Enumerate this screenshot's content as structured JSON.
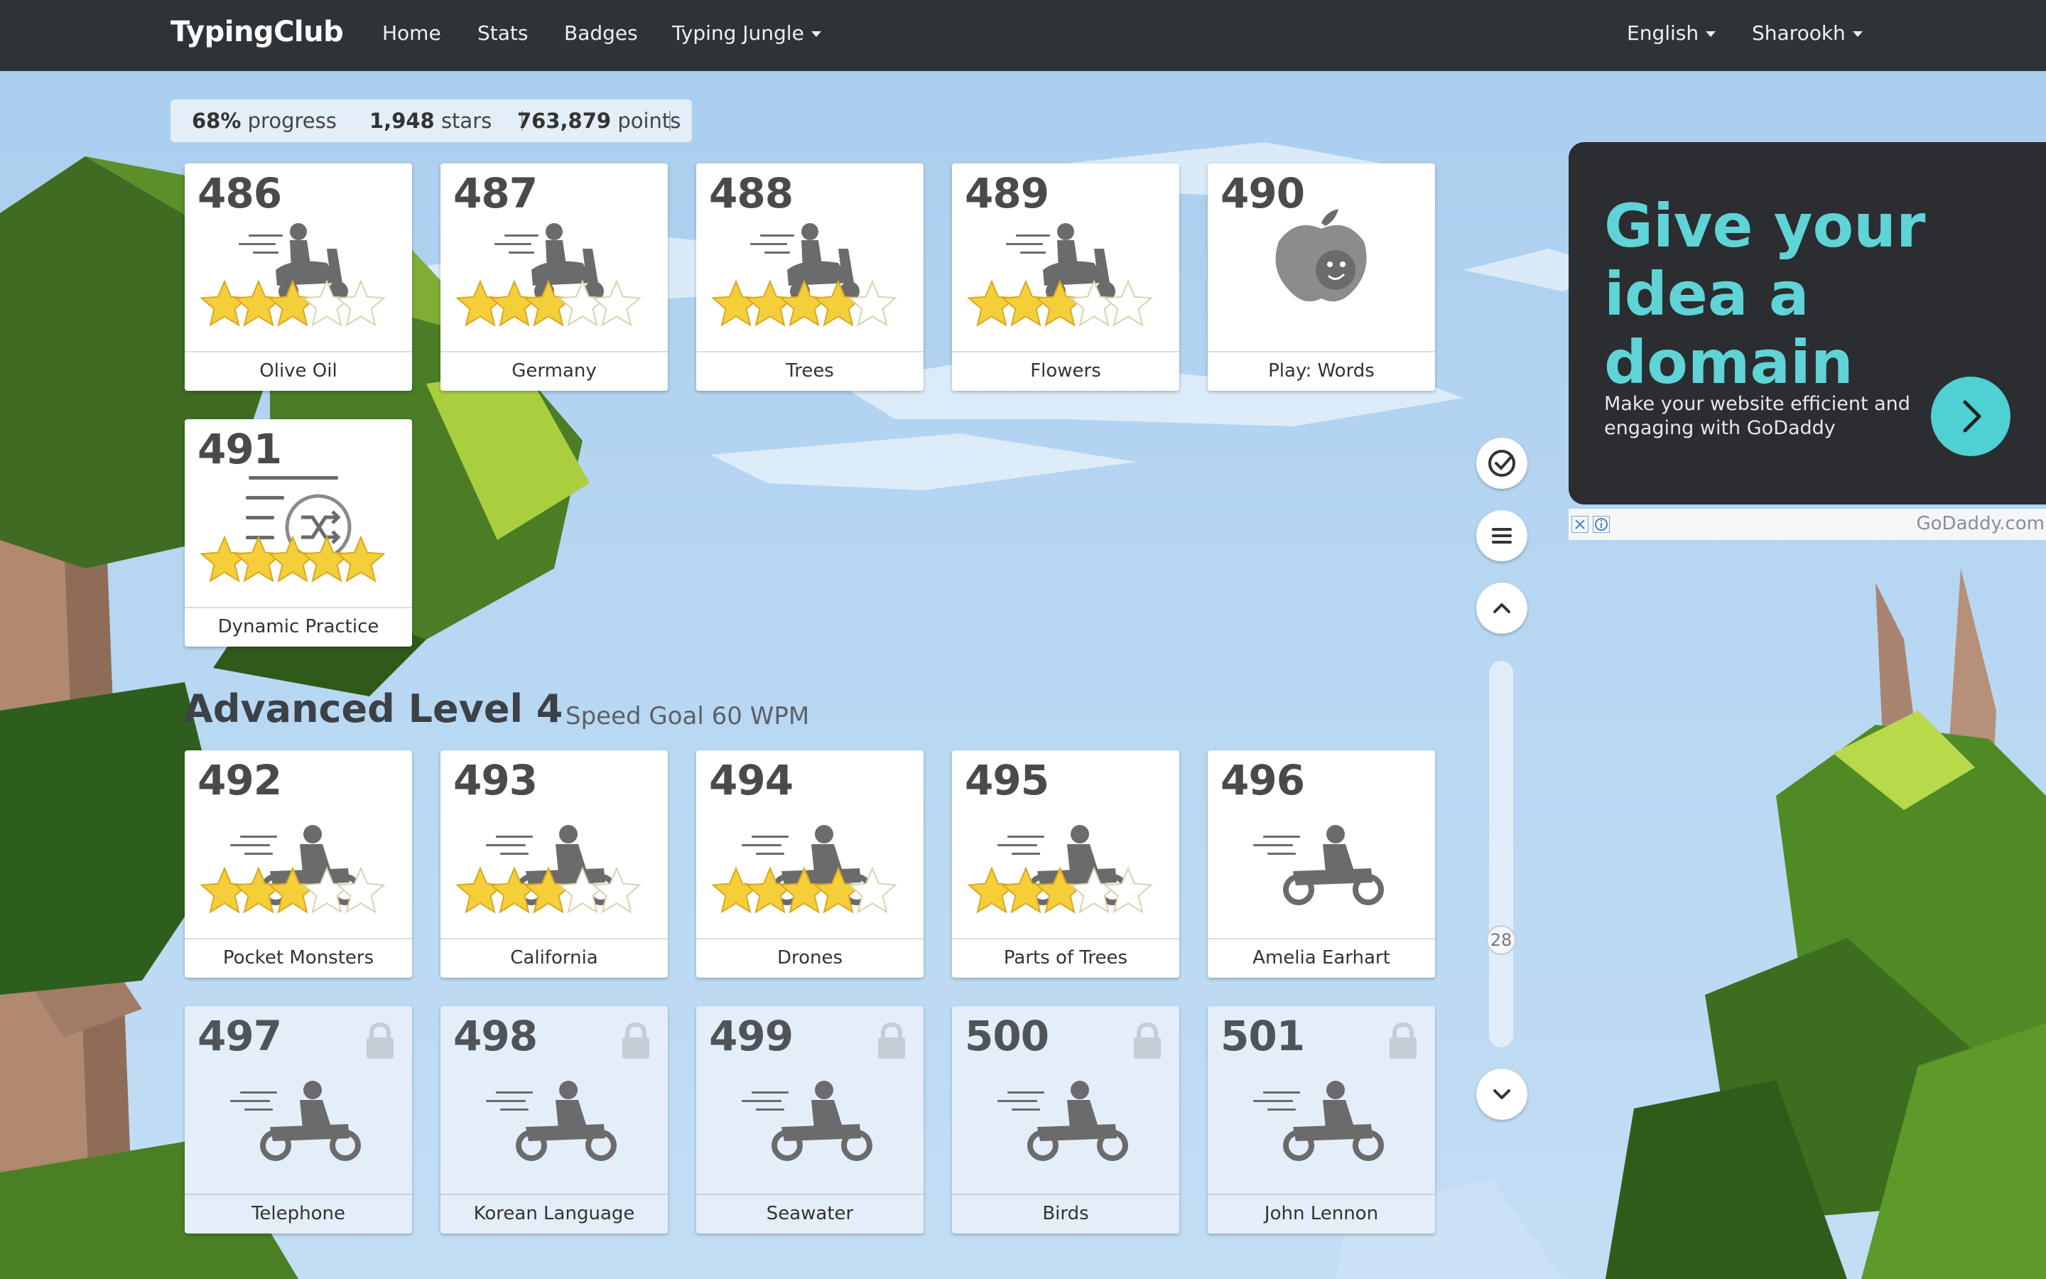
{
  "navbar": {
    "brand": "TypingClub",
    "links": [
      "Home",
      "Stats",
      "Badges",
      "Typing Jungle"
    ],
    "language": "English",
    "user": "Sharookh"
  },
  "stats": {
    "progress_value": "68%",
    "progress_label": "progress",
    "stars_value": "1,948",
    "stars_label": "stars",
    "points_value": "763,879",
    "points_label": "points"
  },
  "lessons_top": [
    {
      "num": "486",
      "label": "Olive Oil",
      "icon": "scooter-rider-icon",
      "stars": 3
    },
    {
      "num": "487",
      "label": "Germany",
      "icon": "scooter-rider-icon",
      "stars": 3
    },
    {
      "num": "488",
      "label": "Trees",
      "icon": "scooter-rider-icon",
      "stars": 4
    },
    {
      "num": "489",
      "label": "Flowers",
      "icon": "scooter-rider-icon",
      "stars": 3
    },
    {
      "num": "490",
      "label": "Play: Words",
      "icon": "apple-game-icon",
      "stars": 0
    },
    {
      "num": "491",
      "label": "Dynamic Practice",
      "icon": "shuffle-list-icon",
      "stars": 5
    }
  ],
  "section": {
    "title": "Advanced Level 4",
    "subtitle": "Speed Goal 60 WPM"
  },
  "lessons_advanced": [
    {
      "num": "492",
      "label": "Pocket Monsters",
      "icon": "motorcycle-rider-icon",
      "stars": 3,
      "locked": false
    },
    {
      "num": "493",
      "label": "California",
      "icon": "motorcycle-rider-icon",
      "stars": 3,
      "locked": false
    },
    {
      "num": "494",
      "label": "Drones",
      "icon": "motorcycle-rider-icon",
      "stars": 4,
      "locked": false
    },
    {
      "num": "495",
      "label": "Parts of Trees",
      "icon": "motorcycle-rider-icon",
      "stars": 3,
      "locked": false
    },
    {
      "num": "496",
      "label": "Amelia Earhart",
      "icon": "motorcycle-rider-icon",
      "stars": 0,
      "locked": false
    },
    {
      "num": "497",
      "label": "Telephone",
      "icon": "motorcycle-rider-icon",
      "stars": 0,
      "locked": true
    },
    {
      "num": "498",
      "label": "Korean Language",
      "icon": "motorcycle-rider-icon",
      "stars": 0,
      "locked": true
    },
    {
      "num": "499",
      "label": "Seawater",
      "icon": "motorcycle-rider-icon",
      "stars": 0,
      "locked": true
    },
    {
      "num": "500",
      "label": "Birds",
      "icon": "motorcycle-rider-icon",
      "stars": 0,
      "locked": true
    },
    {
      "num": "501",
      "label": "John Lennon",
      "icon": "motorcycle-rider-icon",
      "stars": 0,
      "locked": true
    }
  ],
  "side_controls": {
    "icons": [
      "check-circle-icon",
      "menu-icon",
      "chevron-up-icon",
      "chevron-down-icon"
    ],
    "scroll_position": "28"
  },
  "ad": {
    "headline": "Give your idea a domain",
    "body": "Make your website efficient and engaging with GoDaddy",
    "brand": "GoDaddy.com",
    "accent": "#5fd4d6"
  },
  "colors": {
    "navbar": "#2e3338",
    "star_filled": "#f5cf3a",
    "star_empty": "#ffffff",
    "card_locked": "#e4eef9"
  }
}
